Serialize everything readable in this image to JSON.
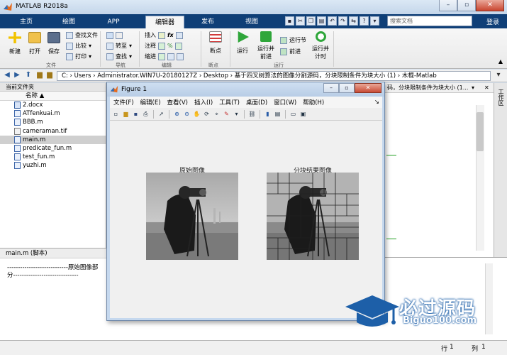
{
  "app": {
    "title": "MATLAB R2018a"
  },
  "tabs": [
    {
      "label": "主页"
    },
    {
      "label": "绘图"
    },
    {
      "label": "APP"
    },
    {
      "label": "编辑器"
    },
    {
      "label": "发布"
    },
    {
      "label": "视图"
    }
  ],
  "search": {
    "placeholder": "搜索文档"
  },
  "login": "登录",
  "ribbon": {
    "file": {
      "new": "新建",
      "open": "打开",
      "save": "保存",
      "find_files": "查找文件",
      "compare": "比较",
      "print": "打印",
      "group": "文件"
    },
    "navigate": {
      "goto": "转至",
      "find": "查找",
      "group": "导航"
    },
    "edit": {
      "insert": "插入",
      "comment": "注释",
      "indent": "缩进",
      "fx": "fx",
      "group": "编辑"
    },
    "breakpoints": {
      "label": "断点",
      "group": "断点"
    },
    "run": {
      "run": "运行",
      "run_advance": "运行并前进",
      "run_section": "运行节",
      "advance": "前进",
      "run_time": "运行并计时",
      "group": "运行"
    }
  },
  "address": {
    "path": "C: › Users › Administrator.WIN7U-20180127Z › Desktop › 基于四叉树算法的图像分割源码，分块限制条件为块大小 (1) › 木棍-Matlab"
  },
  "file_panel": {
    "header": "当前文件夹",
    "column": "名称 ▲",
    "files": [
      {
        "name": "2.docx",
        "type": "doc"
      },
      {
        "name": "ATfenkuai.m",
        "type": "m"
      },
      {
        "name": "BBB.m",
        "type": "m"
      },
      {
        "name": "cameraman.tif",
        "type": "tif"
      },
      {
        "name": "main.m",
        "type": "m",
        "selected": true
      },
      {
        "name": "predicate_fun.m",
        "type": "m"
      },
      {
        "name": "test_fun.m",
        "type": "m"
      },
      {
        "name": "yuzhi.m",
        "type": "m"
      }
    ]
  },
  "details_panel": {
    "header": "main.m  (脚本)",
    "text": "----------------------------原始图像部\n分------------------------------"
  },
  "editor_tab": "码，分块限制条件为块大小 (1...",
  "right_sidebar": "工作区",
  "status": {
    "line_label": "行",
    "line": "1",
    "col_label": "列",
    "col": "1"
  },
  "figure": {
    "title": "Figure 1",
    "menu": [
      "文件(F)",
      "编辑(E)",
      "查看(V)",
      "插入(I)",
      "工具(T)",
      "桌面(D)",
      "窗口(W)",
      "帮助(H)"
    ],
    "axes": [
      {
        "title": "原始图像"
      },
      {
        "title": "分块结果图像"
      }
    ]
  },
  "watermark": {
    "cn": "必过源码",
    "en": "Biguo100.com"
  },
  "colors": {
    "tab_bar": "#0f3f77",
    "accent": "#1d5fa8"
  }
}
